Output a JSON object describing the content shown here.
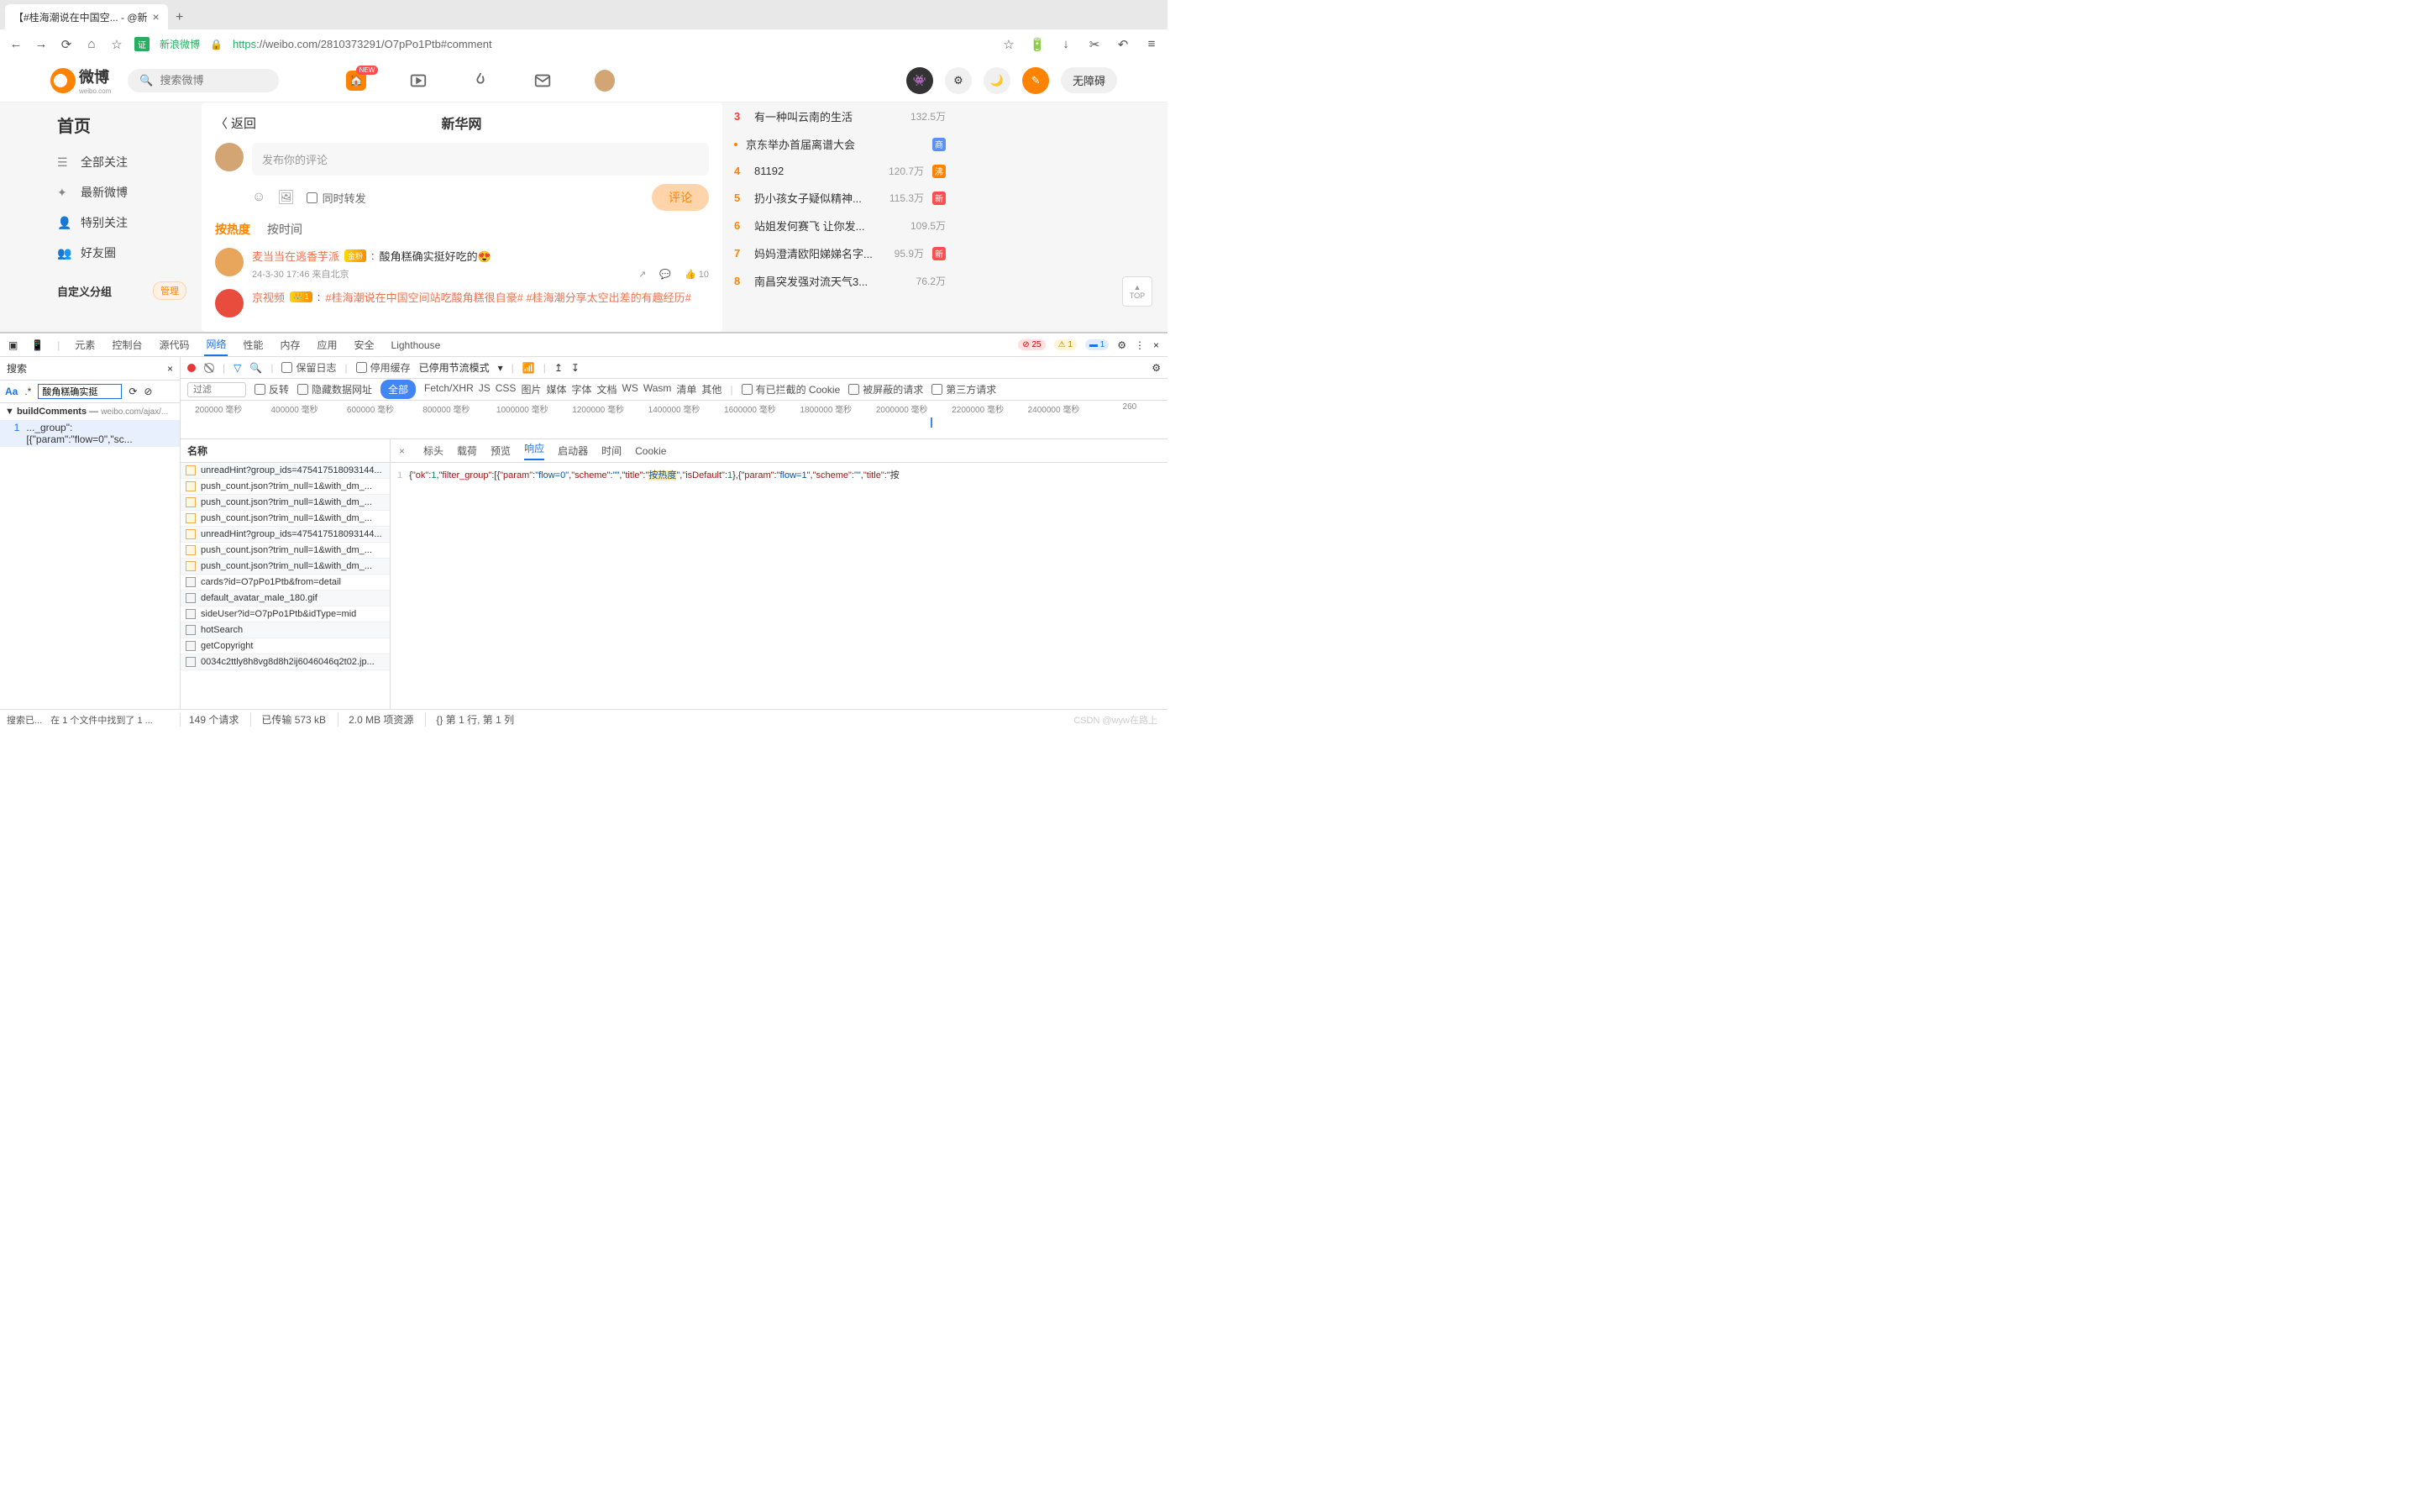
{
  "browser": {
    "tab_title": "【#桂海潮说在中国空... - @新",
    "site_badge": "证",
    "site_name": "新浪微博",
    "url_protocol": "https",
    "url_rest": "://weibo.com/2810373291/O7pPo1Ptb#comment"
  },
  "weibo": {
    "logo_text": "微博",
    "logo_sub": "weibo.com",
    "search_placeholder": "搜索微博",
    "accessibility": "无障碍",
    "new_badge": "NEW",
    "sidebar": {
      "home": "首页",
      "items": [
        "全部关注",
        "最新微博",
        "特别关注",
        "好友圈"
      ],
      "custom_group": "自定义分组",
      "manage": "管理"
    },
    "main": {
      "back": "返回",
      "page_title": "新华网",
      "comment_placeholder": "发布你的评论",
      "repost_same": "同时转发",
      "publish": "评论",
      "sort_hot": "按热度",
      "sort_time": "按时间",
      "comment1": {
        "user": "麦当当在逃香芋派",
        "badge": "金粉",
        "text": "酸角糕确实挺好吃的😍",
        "meta": "24-3-30 17:46 来自北京",
        "likes": "10"
      },
      "comment2": {
        "user": "京视频",
        "crown": "👑 1",
        "text": "#桂海潮说在中国空间站吃酸角糕很自豪# #桂海潮分享太空出差的有趣经历#"
      }
    },
    "hotlist": [
      {
        "rank": "3",
        "text": "有一种叫云南的生活",
        "count": "132.5万",
        "tag": ""
      },
      {
        "rank": "·",
        "text": "京东举办首届离谱大会",
        "count": "",
        "tag": "商",
        "tagcolor": "blue"
      },
      {
        "rank": "4",
        "text": "81192",
        "count": "120.7万",
        "tag": "沸",
        "tagcolor": "orange"
      },
      {
        "rank": "5",
        "text": "扔小孩女子疑似精神...",
        "count": "115.3万",
        "tag": "新",
        "tagcolor": "red"
      },
      {
        "rank": "6",
        "text": "站姐发何赛飞 让你发...",
        "count": "109.5万",
        "tag": ""
      },
      {
        "rank": "7",
        "text": "妈妈澄清欧阳娣娣名字...",
        "count": "95.9万",
        "tag": "新",
        "tagcolor": "red"
      },
      {
        "rank": "8",
        "text": "南昌突发强对流天气3...",
        "count": "76.2万",
        "tag": ""
      }
    ],
    "top_btn": "TOP"
  },
  "devtools": {
    "tabs": [
      "元素",
      "控制台",
      "源代码",
      "网络",
      "性能",
      "内存",
      "应用",
      "安全",
      "Lighthouse"
    ],
    "active_tab": "网络",
    "errors": "25",
    "warnings": "1",
    "messages": "1",
    "search_title": "搜索",
    "search_value": "酸角糕确实挺",
    "search_match_aa": "Aa",
    "search_match_re": ".*",
    "search_result_title": "buildComments",
    "search_result_file": "weibo.com/ajax/...",
    "search_match_line": "1",
    "search_match_text": "..._group\":[{\"param\":\"flow=0\",\"sc...",
    "keep_log": "保留日志",
    "disable_cache": "停用缓存",
    "throttle": "已停用节流模式",
    "filter_placeholder": "过滤",
    "invert": "反转",
    "hide_data": "隐藏数据网址",
    "all": "全部",
    "filter_types": [
      "Fetch/XHR",
      "JS",
      "CSS",
      "图片",
      "媒体",
      "字体",
      "文档",
      "WS",
      "Wasm",
      "清单",
      "其他"
    ],
    "blocked_cookie": "有已拦截的 Cookie",
    "blocked_req": "被屏蔽的请求",
    "third_party": "第三方请求",
    "timeline_labels": [
      "200000 毫秒",
      "400000 毫秒",
      "600000 毫秒",
      "800000 毫秒",
      "1000000 毫秒",
      "1200000 毫秒",
      "1400000 毫秒",
      "1600000 毫秒",
      "1800000 毫秒",
      "2000000 毫秒",
      "2200000 毫秒",
      "2400000 毫秒",
      "260"
    ],
    "name_header": "名称",
    "requests": [
      "unreadHint?group_ids=475417518093144...",
      "push_count.json?trim_null=1&with_dm_...",
      "push_count.json?trim_null=1&with_dm_...",
      "push_count.json?trim_null=1&with_dm_...",
      "unreadHint?group_ids=475417518093144...",
      "push_count.json?trim_null=1&with_dm_...",
      "push_count.json?trim_null=1&with_dm_...",
      "cards?id=O7pPo1Ptb&from=detail",
      "default_avatar_male_180.gif",
      "sideUser?id=O7pPo1Ptb&idType=mid",
      "hotSearch",
      "getCopyright",
      "0034c2ttly8h8vg8d8h2ij6046046q2t02.jp..."
    ],
    "resp_tabs": [
      "标头",
      "载荷",
      "预览",
      "响应",
      "启动器",
      "时间",
      "Cookie"
    ],
    "resp_active": "响应",
    "resp_line": "1",
    "resp_json": "{\"ok\":1,\"filter_group\":[{\"param\":\"flow=0\",\"scheme\":\"\",\"title\":\"按热度\",\"isDefault\":1},{\"param\":\"flow=1\",\"scheme\":\"\",\"title\":\"按",
    "status_left1": "搜索已...",
    "status_left2": "在 1 个文件中找到了 1 ...",
    "status_reqs": "149 个请求",
    "status_transfer": "已传输 573 kB",
    "status_resources": "2.0 MB 项资源",
    "status_cursor": "第 1 行, 第 1 列",
    "watermark": "CSDN @wyw在路上"
  }
}
